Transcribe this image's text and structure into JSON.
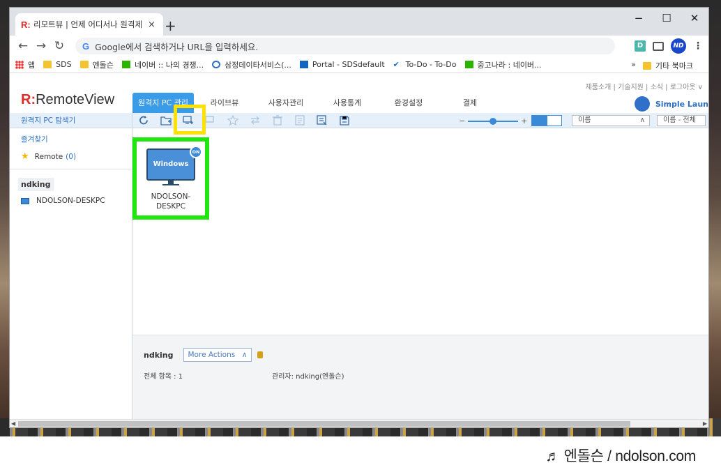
{
  "browser": {
    "tab_title": "리모트뷰 | 언제 어디서나 원격제",
    "tab_favicon": "R:",
    "close_tab": "×",
    "new_tab": "+",
    "minimize": "−",
    "maximize": "☐",
    "close_window": "✕",
    "back": "←",
    "forward": "→",
    "reload": "↻",
    "omnibox_g": "G",
    "omnibox_text": "Google에서 검색하거나 URL을 입력하세요.",
    "ext_label": "D",
    "profile_initials": "ND",
    "menu": "⋮"
  },
  "bookmarks": {
    "items": [
      {
        "label": "앱",
        "icon": "apps-icon"
      },
      {
        "label": "SDS",
        "icon": "folder-icon"
      },
      {
        "label": "엔돌슨",
        "icon": "folder-icon"
      },
      {
        "label": "네이버 :: 나의 경쟁...",
        "icon": "naver-icon"
      },
      {
        "label": "삼정데이타서비스(...",
        "icon": "globe-icon"
      },
      {
        "label": "Portal - SDSdefault",
        "icon": "portal-icon"
      },
      {
        "label": "To-Do - To-Do",
        "icon": "check-icon"
      },
      {
        "label": "중고나라 : 네이버...",
        "icon": "cafe-icon"
      }
    ],
    "more": "»",
    "other": "기타 북마크"
  },
  "app": {
    "logo_mark": "R:",
    "logo_text": "RemoteView",
    "top_links": "제품소개 | 기술지원 | 소식 | 로그아웃 ∨",
    "tabs": [
      "원격지 PC 관리",
      "라이브뷰",
      "사용자관리",
      "사용통계",
      "환경설정",
      "결제"
    ],
    "launcher": "Simple Laun",
    "colors": {
      "accent": "#3a9be8",
      "highlight_yellow": "#ffe100",
      "highlight_green": "#22e60f"
    }
  },
  "sidebar": {
    "header": "원격지 PC 탐색기",
    "favorites_title": "즐겨찾기",
    "favorite_item": "Remote",
    "favorite_count": "(0)",
    "group": "ndking",
    "pc_item": "NDOLSON-DESKPC"
  },
  "toolbar": {
    "zoom_minus": "−",
    "zoom_plus": "+",
    "zoom_level": 0.5,
    "sort_label": "이름",
    "sort_chevron": "∧",
    "filter_label": "이름 - 전체"
  },
  "content": {
    "pc_screen": "Windows",
    "pc_status": "ON",
    "pc_name": "NDOLSON-DESKPC"
  },
  "details": {
    "name": "ndking",
    "more_actions": "More Actions",
    "more_chevron": "∧",
    "total": "전체 항목 : 1",
    "admin": "관리자: ndking(엔돌슨)"
  },
  "footer": {
    "watermark": "♬ 엔돌슨 / ndolson.com"
  }
}
